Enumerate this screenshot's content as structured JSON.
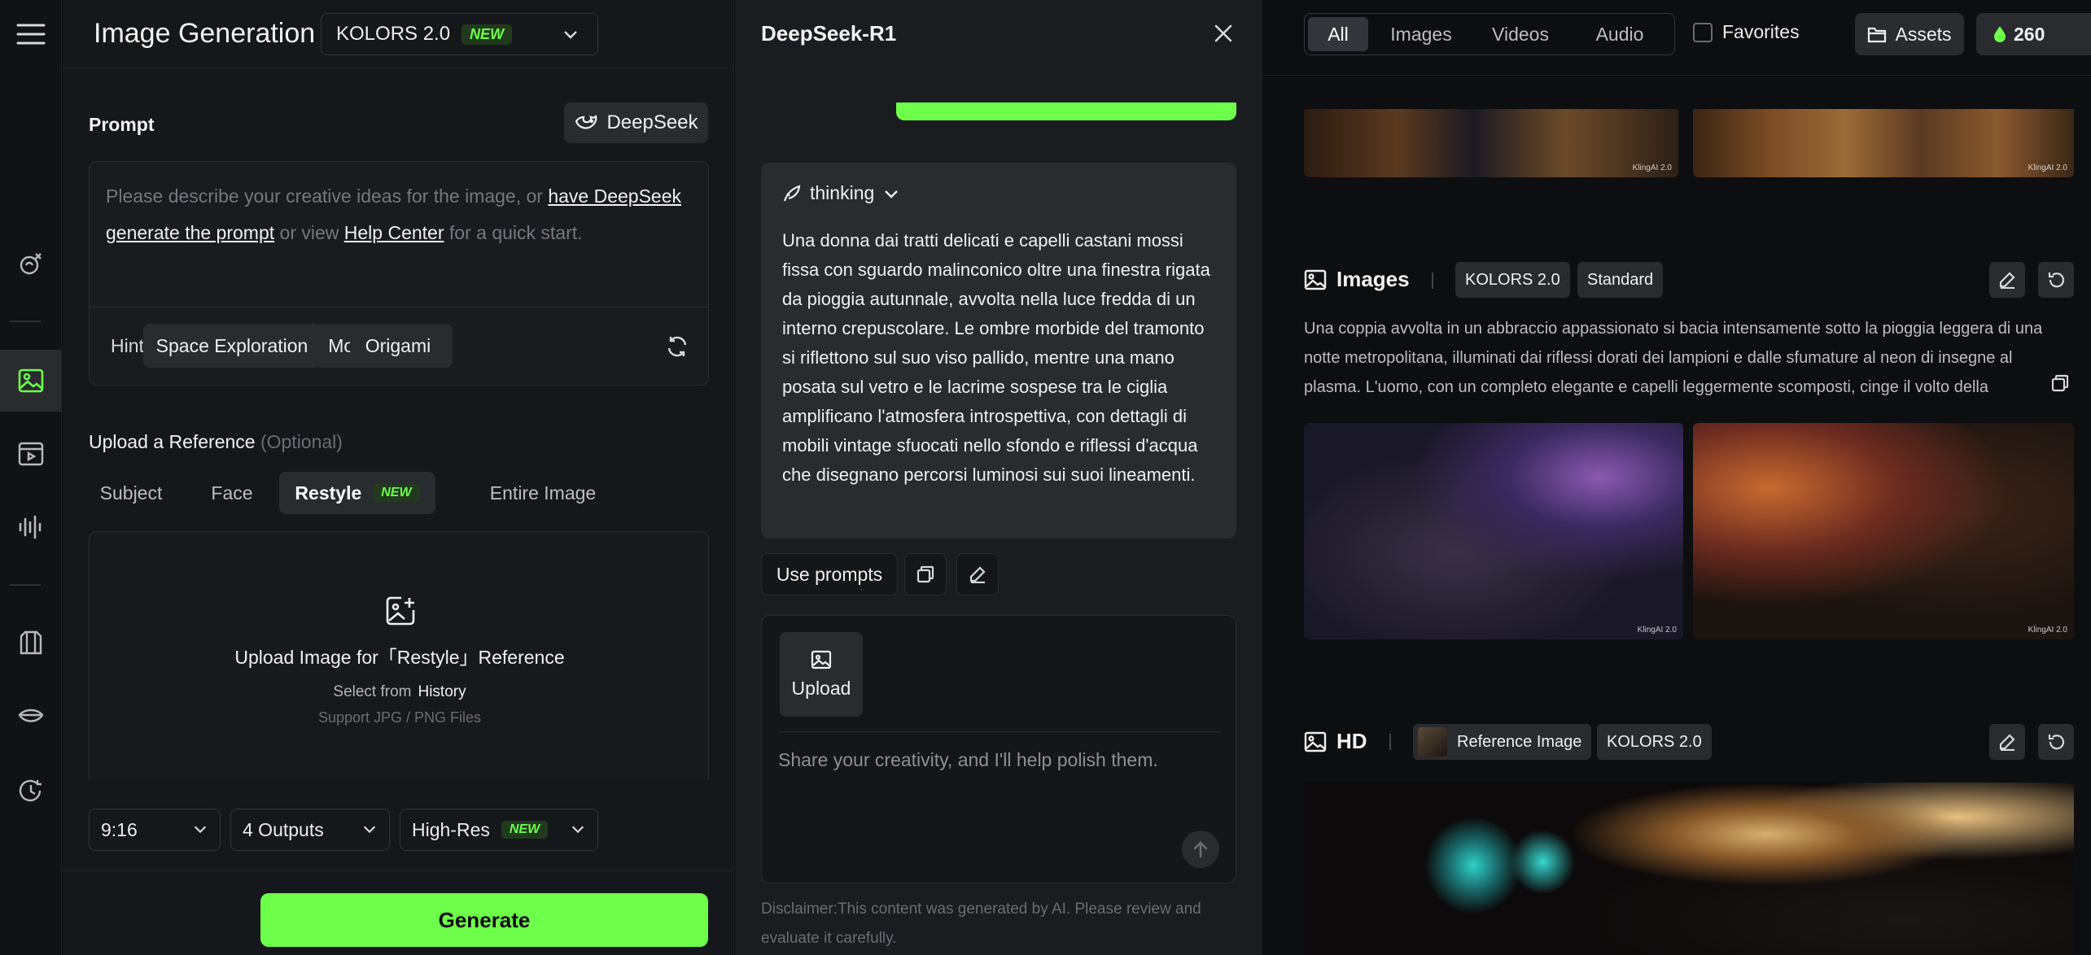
{
  "left": {
    "title": "Image Generation",
    "model": {
      "name": "KOLORS 2.0",
      "badge": "NEW"
    },
    "prompt_label": "Prompt",
    "deepseek_label": "DeepSeek",
    "prompt": {
      "text_1": "Please describe your creative ideas for the image, or ",
      "link_1": "have DeepSeek generate the prompt",
      "text_2": " or view ",
      "link_2": "Help Center",
      "text_3": " for a quick start."
    },
    "hints_label": "Hints:",
    "hints": [
      "Space Exploration",
      "Modern party",
      "Origami"
    ],
    "reference_label": "Upload a Reference",
    "reference_optional": "(Optional)",
    "ref_tabs": [
      "Subject",
      "Face",
      "Restyle",
      "Entire Image"
    ],
    "ref_badge": "NEW",
    "upload": {
      "title": "Upload Image for「Restyle」Reference",
      "select_from": "Select from",
      "history": "History",
      "support": "Support JPG / PNG Files"
    },
    "ratio": "9:16",
    "outputs": "4 Outputs",
    "quality": "High-Res",
    "quality_badge": "NEW",
    "generate": "Generate"
  },
  "middle": {
    "title": "DeepSeek-R1",
    "thinking_label": "thinking",
    "thinking_text": "Una donna dai tratti delicati e capelli castani mossi fissa con sguardo malinconico oltre una finestra rigata da pioggia autunnale, avvolta nella luce fredda di un interno crepuscolare. Le ombre morbide del tramonto si riflettono sul suo viso pallido, mentre una mano posata sul vetro e le lacrime sospese tra le ciglia amplificano l'atmosfera introspettiva, con dettagli di mobili vintage sfuocati nello sfondo e riflessi d'acqua che disegnano percorsi luminosi sui suoi lineamenti.",
    "use_prompts": "Use prompts",
    "upload_label": "Upload",
    "chat_placeholder": "Share your creativity, and I'll help polish them.",
    "disclaimer": "Disclaimer:This content was generated by AI. Please review and evaluate it carefully."
  },
  "right": {
    "filters": [
      "All",
      "Images",
      "Videos",
      "Audio"
    ],
    "favorites": "Favorites",
    "assets": "Assets",
    "credits": "260",
    "watermark": "KlingAI 2.0",
    "section_1": {
      "title": "Images",
      "tags": [
        "KOLORS 2.0",
        "Standard"
      ],
      "description": "Una coppia avvolta in un abbraccio appassionato si bacia intensamente sotto la pioggia leggera di una notte metropolitana, illuminati dai riflessi dorati dei lampioni e dalle sfumature al neon di insegne al plasma. L'uomo, con un completo elegante e capelli leggermente scomposti, cinge il volto della"
    },
    "section_2": {
      "title": "HD",
      "tags": [
        "Reference Image",
        "KOLORS 2.0"
      ]
    }
  },
  "colors": {
    "accent": "#6dff4a",
    "panel": "#16171a",
    "chip": "#2a2b2f"
  }
}
